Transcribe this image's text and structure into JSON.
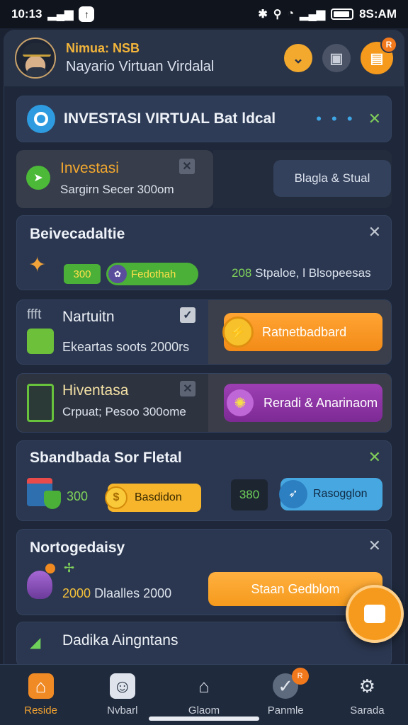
{
  "status_bar": {
    "time_left": "10:13",
    "time_right": "8S:AM"
  },
  "header": {
    "name": "Nimua: NSB",
    "subtitle": "Nayario Virtuan Virdalal",
    "badge": "R"
  },
  "banner": {
    "title": "INVESTASI VIRTUAL Bat ldcal",
    "dots": "• • •",
    "close": "✕"
  },
  "investasi": {
    "title": "Investasi",
    "subtitle": "Sargirn Secer 300om",
    "button": "Blagla & Stual"
  },
  "card1": {
    "title": "Beivecadaltie",
    "tag": "300",
    "pill": "Fedothah",
    "right_num": "208",
    "right_text": "Stpaloe, l Blsopeesas",
    "close": "✕"
  },
  "card2": {
    "icon_text": "ffft",
    "title": "Nartuitn",
    "subtitle": "Ekeartas soots 2000rs",
    "button": "Ratnetbadbard"
  },
  "card3": {
    "title": "Hiventasa",
    "subtitle": "Crpuat; Pesoo 300ome",
    "button": "Reradi & Anarinaom"
  },
  "card4": {
    "title": "Sbandbada Sor Fletal",
    "num": "300",
    "btn_yellow": "Basdidon",
    "num_box": "380",
    "btn_blue": "Rasogglon",
    "close": "✕"
  },
  "card5": {
    "title": "Nortogedaisy",
    "num": "2000",
    "subtitle": "Dlaalles 2000",
    "button": "Staan Gedblom",
    "close": "✕"
  },
  "card6": {
    "title": "Dadika Aingntans"
  },
  "nav": [
    {
      "label": "Reside",
      "icon": "home-icon"
    },
    {
      "label": "Nvbarl",
      "icon": "face-icon"
    },
    {
      "label": "Glaom",
      "icon": "building-icon"
    },
    {
      "label": "Panmle",
      "icon": "check-icon",
      "badge": "R"
    },
    {
      "label": "Sarada",
      "icon": "gear-icon"
    }
  ],
  "colors": {
    "accent": "#f59a1c",
    "green": "#4ab038",
    "purple": "#8a2fa3",
    "blue": "#47a7e0",
    "bg": "#1e283a"
  }
}
